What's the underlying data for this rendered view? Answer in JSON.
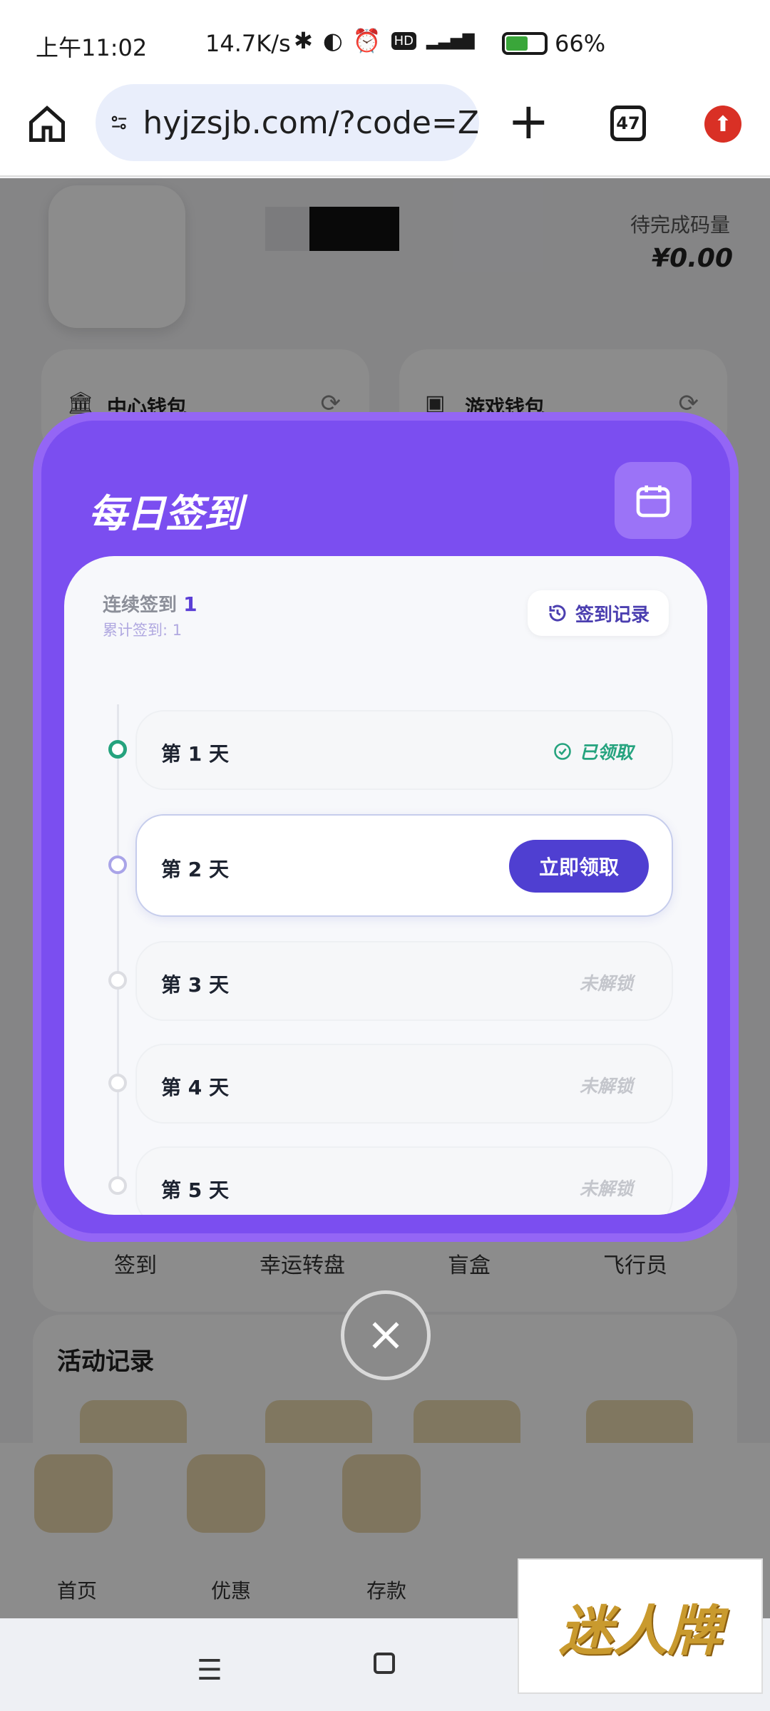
{
  "status_bar": {
    "time": "上午11:02",
    "speed": "14.7K/s",
    "battery": "66%"
  },
  "browser": {
    "url": "hyjzsjb.com/?code=Z",
    "tab_count": "47"
  },
  "page": {
    "pending_label": "待完成码量",
    "pending_value": "¥0.00",
    "center_wallet": "中心钱包",
    "game_wallet": "游戏钱包",
    "quick": [
      "签到",
      "幸运转盘",
      "盲盒",
      "飞行员"
    ],
    "activity_title": "活动记录",
    "tabs": [
      "首页",
      "优惠",
      "存款"
    ]
  },
  "modal": {
    "title": "每日签到",
    "streak_label": "连续签到",
    "streak_value": "1",
    "total_label": "累计签到: 1",
    "record_button": "签到记录",
    "days": [
      {
        "label": "第 1 天",
        "status": "已领取",
        "state": "claimed"
      },
      {
        "label": "第 2 天",
        "status": "立即领取",
        "state": "current"
      },
      {
        "label": "第 3 天",
        "status": "未解锁",
        "state": "locked"
      },
      {
        "label": "第 4 天",
        "status": "未解锁",
        "state": "locked"
      },
      {
        "label": "第 5 天",
        "status": "未解锁",
        "state": "locked"
      }
    ]
  },
  "watermark": "迷人牌",
  "colors": {
    "modal_purple": "#7b4ef0",
    "claim_button": "#4f3fd1",
    "claimed_green": "#25a37e"
  },
  "icons": [
    "home-icon",
    "site-settings-icon",
    "plus-icon",
    "tabs-icon",
    "update-icon",
    "calendar-icon",
    "history-icon",
    "check-circle-icon",
    "close-icon",
    "wallet-icon",
    "bank-icon",
    "refresh-icon"
  ]
}
